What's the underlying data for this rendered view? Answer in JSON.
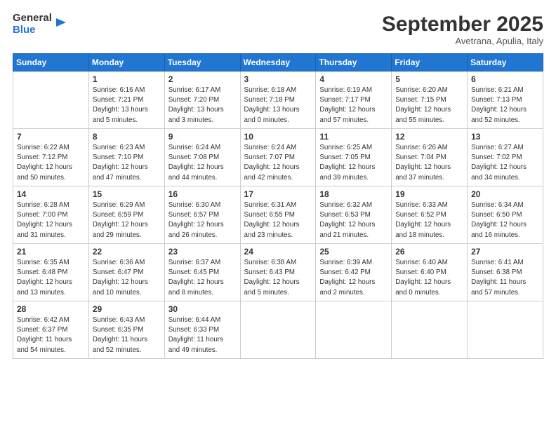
{
  "logo": {
    "line1": "General",
    "line2": "Blue"
  },
  "header": {
    "month": "September 2025",
    "location": "Avetrana, Apulia, Italy"
  },
  "days_of_week": [
    "Sunday",
    "Monday",
    "Tuesday",
    "Wednesday",
    "Thursday",
    "Friday",
    "Saturday"
  ],
  "weeks": [
    [
      {
        "day": "",
        "info": ""
      },
      {
        "day": "1",
        "info": "Sunrise: 6:16 AM\nSunset: 7:21 PM\nDaylight: 13 hours\nand 5 minutes."
      },
      {
        "day": "2",
        "info": "Sunrise: 6:17 AM\nSunset: 7:20 PM\nDaylight: 13 hours\nand 3 minutes."
      },
      {
        "day": "3",
        "info": "Sunrise: 6:18 AM\nSunset: 7:18 PM\nDaylight: 13 hours\nand 0 minutes."
      },
      {
        "day": "4",
        "info": "Sunrise: 6:19 AM\nSunset: 7:17 PM\nDaylight: 12 hours\nand 57 minutes."
      },
      {
        "day": "5",
        "info": "Sunrise: 6:20 AM\nSunset: 7:15 PM\nDaylight: 12 hours\nand 55 minutes."
      },
      {
        "day": "6",
        "info": "Sunrise: 6:21 AM\nSunset: 7:13 PM\nDaylight: 12 hours\nand 52 minutes."
      }
    ],
    [
      {
        "day": "7",
        "info": "Sunrise: 6:22 AM\nSunset: 7:12 PM\nDaylight: 12 hours\nand 50 minutes."
      },
      {
        "day": "8",
        "info": "Sunrise: 6:23 AM\nSunset: 7:10 PM\nDaylight: 12 hours\nand 47 minutes."
      },
      {
        "day": "9",
        "info": "Sunrise: 6:24 AM\nSunset: 7:08 PM\nDaylight: 12 hours\nand 44 minutes."
      },
      {
        "day": "10",
        "info": "Sunrise: 6:24 AM\nSunset: 7:07 PM\nDaylight: 12 hours\nand 42 minutes."
      },
      {
        "day": "11",
        "info": "Sunrise: 6:25 AM\nSunset: 7:05 PM\nDaylight: 12 hours\nand 39 minutes."
      },
      {
        "day": "12",
        "info": "Sunrise: 6:26 AM\nSunset: 7:04 PM\nDaylight: 12 hours\nand 37 minutes."
      },
      {
        "day": "13",
        "info": "Sunrise: 6:27 AM\nSunset: 7:02 PM\nDaylight: 12 hours\nand 34 minutes."
      }
    ],
    [
      {
        "day": "14",
        "info": "Sunrise: 6:28 AM\nSunset: 7:00 PM\nDaylight: 12 hours\nand 31 minutes."
      },
      {
        "day": "15",
        "info": "Sunrise: 6:29 AM\nSunset: 6:59 PM\nDaylight: 12 hours\nand 29 minutes."
      },
      {
        "day": "16",
        "info": "Sunrise: 6:30 AM\nSunset: 6:57 PM\nDaylight: 12 hours\nand 26 minutes."
      },
      {
        "day": "17",
        "info": "Sunrise: 6:31 AM\nSunset: 6:55 PM\nDaylight: 12 hours\nand 23 minutes."
      },
      {
        "day": "18",
        "info": "Sunrise: 6:32 AM\nSunset: 6:53 PM\nDaylight: 12 hours\nand 21 minutes."
      },
      {
        "day": "19",
        "info": "Sunrise: 6:33 AM\nSunset: 6:52 PM\nDaylight: 12 hours\nand 18 minutes."
      },
      {
        "day": "20",
        "info": "Sunrise: 6:34 AM\nSunset: 6:50 PM\nDaylight: 12 hours\nand 16 minutes."
      }
    ],
    [
      {
        "day": "21",
        "info": "Sunrise: 6:35 AM\nSunset: 6:48 PM\nDaylight: 12 hours\nand 13 minutes."
      },
      {
        "day": "22",
        "info": "Sunrise: 6:36 AM\nSunset: 6:47 PM\nDaylight: 12 hours\nand 10 minutes."
      },
      {
        "day": "23",
        "info": "Sunrise: 6:37 AM\nSunset: 6:45 PM\nDaylight: 12 hours\nand 8 minutes."
      },
      {
        "day": "24",
        "info": "Sunrise: 6:38 AM\nSunset: 6:43 PM\nDaylight: 12 hours\nand 5 minutes."
      },
      {
        "day": "25",
        "info": "Sunrise: 6:39 AM\nSunset: 6:42 PM\nDaylight: 12 hours\nand 2 minutes."
      },
      {
        "day": "26",
        "info": "Sunrise: 6:40 AM\nSunset: 6:40 PM\nDaylight: 12 hours\nand 0 minutes."
      },
      {
        "day": "27",
        "info": "Sunrise: 6:41 AM\nSunset: 6:38 PM\nDaylight: 11 hours\nand 57 minutes."
      }
    ],
    [
      {
        "day": "28",
        "info": "Sunrise: 6:42 AM\nSunset: 6:37 PM\nDaylight: 11 hours\nand 54 minutes."
      },
      {
        "day": "29",
        "info": "Sunrise: 6:43 AM\nSunset: 6:35 PM\nDaylight: 11 hours\nand 52 minutes."
      },
      {
        "day": "30",
        "info": "Sunrise: 6:44 AM\nSunset: 6:33 PM\nDaylight: 11 hours\nand 49 minutes."
      },
      {
        "day": "",
        "info": ""
      },
      {
        "day": "",
        "info": ""
      },
      {
        "day": "",
        "info": ""
      },
      {
        "day": "",
        "info": ""
      }
    ]
  ]
}
